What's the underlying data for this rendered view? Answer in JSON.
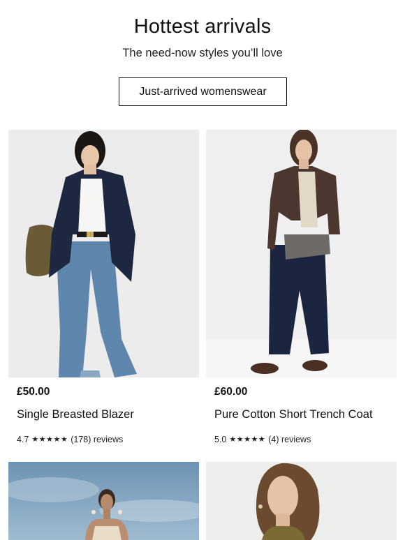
{
  "hero": {
    "title": "Hottest arrivals",
    "subtitle": "The need-now styles you’ll love",
    "cta_label": "Just-arrived womenswear"
  },
  "products": [
    {
      "price": "£50.00",
      "name": "Single Breasted Blazer",
      "rating": "4.7",
      "stars": "★★★★★",
      "reviews": "(178) reviews"
    },
    {
      "price": "£60.00",
      "name": "Pure Cotton Short Trench Coat",
      "rating": "5.0",
      "stars": "★★★★★",
      "reviews": "(4) reviews"
    }
  ],
  "colors": {
    "text": "#111111",
    "photo_bg_light": "#eeeeee",
    "sky": "#7fa6c4"
  }
}
